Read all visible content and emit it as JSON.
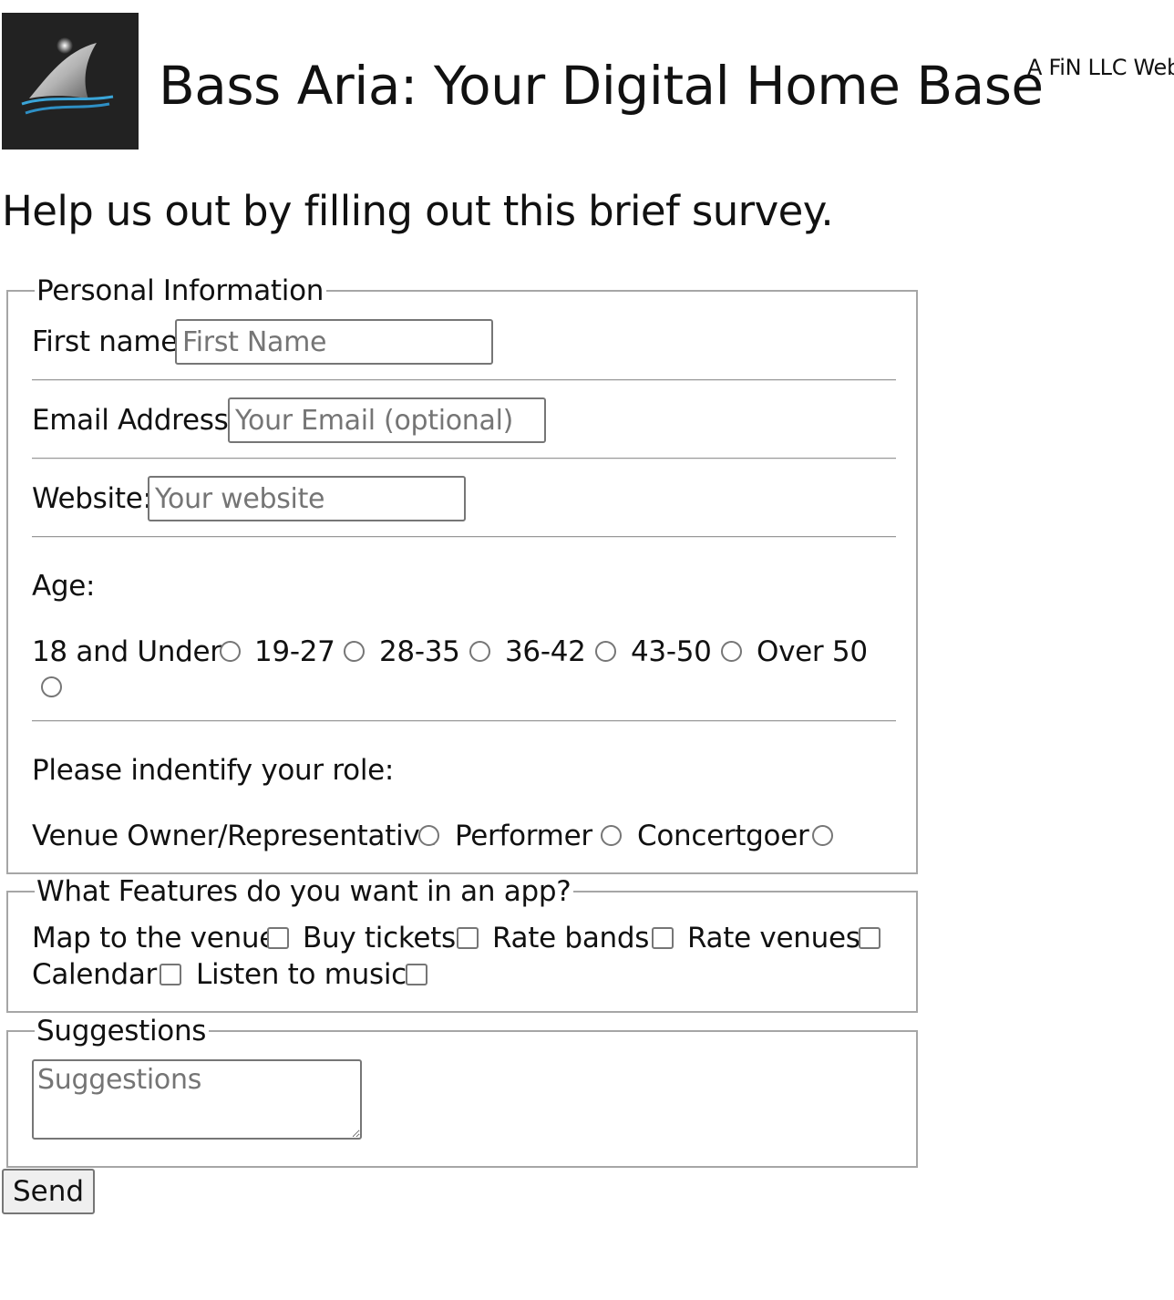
{
  "header": {
    "logo_icon": "shark-fin-logo-icon",
    "title": "Bass Aria: Your Digital Home Base",
    "tagline": "A FiN LLC Web"
  },
  "intro": "Help us out by filling out this brief survey.",
  "personal": {
    "legend": "Personal Information",
    "first_name_label": "First name",
    "first_name_placeholder": "First Name",
    "email_label": "Email Address:",
    "email_placeholder": "Your Email (optional)",
    "website_label": "Website:",
    "website_placeholder": "Your website",
    "age_label": "Age:",
    "age_options": [
      "18 and Under",
      "19-27",
      "28-35",
      "36-42",
      "43-50",
      "Over 50"
    ],
    "role_label": "Please indentify your role:",
    "role_options": [
      "Venue Owner/Representative",
      "Performer",
      "Concertgoer"
    ]
  },
  "features": {
    "legend": "What Features do you want in an app?",
    "options": [
      "Map to the venue",
      "Buy tickets",
      "Rate bands",
      "Rate venues",
      "Calendar",
      "Listen to music"
    ]
  },
  "suggestions": {
    "legend": "Suggestions",
    "placeholder": "Suggestions"
  },
  "send_label": "Send",
  "colors": {
    "logo_bg": "#222222",
    "fieldset_border": "#a6a6a6",
    "button_bg": "#efefef"
  }
}
